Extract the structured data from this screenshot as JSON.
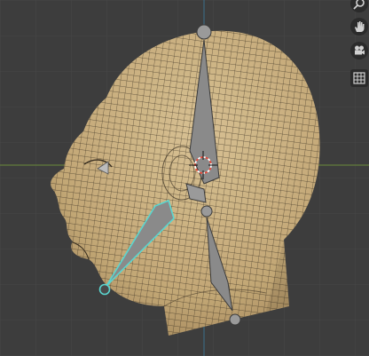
{
  "viewport": {
    "background": "#3d3d3d",
    "grid_color": "#464646",
    "axis_y_color": "#3c6e8c",
    "axis_x_color": "#6b8a3a"
  },
  "mesh": {
    "skin_color": "#d9c08f",
    "shadow_color": "#a88b5d",
    "wire_color": "#3a3022"
  },
  "armature": {
    "bone_color": "#8a8a8a",
    "bone_outline": "#3a3a3a",
    "selected_color": "#5ad6d0",
    "cursor_colors": [
      "#e84a3a",
      "#ffffff"
    ]
  },
  "nav_gizmo": {
    "buttons": [
      {
        "name": "zoom",
        "icon": "magnifier-icon"
      },
      {
        "name": "pan",
        "icon": "hand-icon"
      },
      {
        "name": "camera",
        "icon": "camera-icon"
      },
      {
        "name": "perspective",
        "icon": "grid-icon"
      }
    ]
  }
}
